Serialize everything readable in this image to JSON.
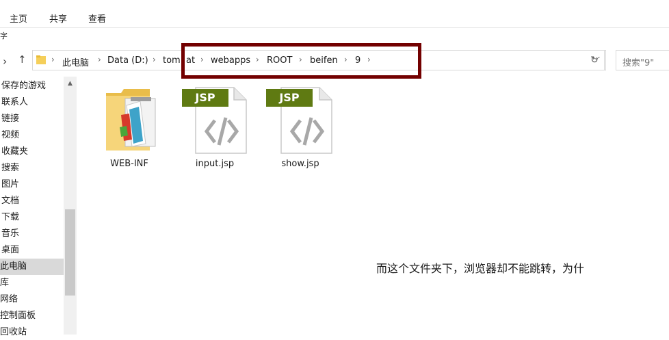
{
  "ribbon": {
    "tabs": [
      "主页",
      "共享",
      "查看"
    ],
    "cut_char": "字"
  },
  "nav": {
    "back_glyph": "‹",
    "up_glyph": "↑"
  },
  "address": {
    "crumbs": [
      "此电脑",
      "Data (D:)",
      "tomcat",
      "webapps",
      "ROOT",
      "beifen",
      "9"
    ],
    "crumb_visible": [
      "此电脑",
      "Data (D:)",
      "tom",
      "at",
      "webapps",
      "ROOT",
      "beifen",
      "9"
    ]
  },
  "search": {
    "placeholder": "搜索\"9\""
  },
  "sidebar": {
    "items": [
      "保存的游戏",
      "联系人",
      "链接",
      "视频",
      "收藏夹",
      "搜索",
      "图片",
      "文档",
      "下载",
      "音乐",
      "桌面",
      "此电脑",
      "库",
      "网络",
      "控制面板",
      "回收站"
    ],
    "selected": "此电脑"
  },
  "files": [
    {
      "name": "WEB-INF",
      "type": "folder"
    },
    {
      "name": "input.jsp",
      "type": "jsp",
      "badge": "JSP"
    },
    {
      "name": "show.jsp",
      "type": "jsp",
      "badge": "JSP"
    }
  ],
  "note": "而这个文件夹下，浏览器却不能跳转，为什"
}
